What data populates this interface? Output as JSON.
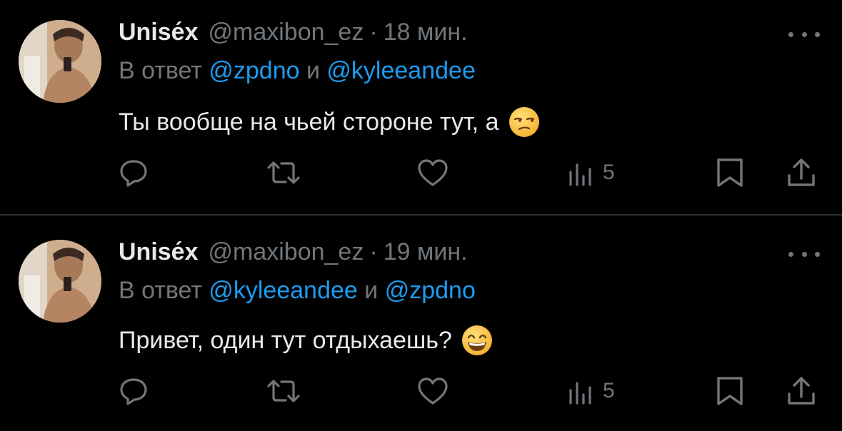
{
  "tweets": [
    {
      "author": {
        "display_name": "Unisе́x",
        "handle": "@maxibon_ez"
      },
      "separator": "·",
      "time": "18 мин.",
      "reply_prefix": "В ответ",
      "mention_1": "@zpdno",
      "conjunction": "и",
      "mention_2": "@kyleeandee",
      "text": "Ты вообще на чьей стороне тут, а",
      "emoji": "unamused-face",
      "views": "5"
    },
    {
      "author": {
        "display_name": "Unisе́x",
        "handle": "@maxibon_ez"
      },
      "separator": "·",
      "time": "19 мин.",
      "reply_prefix": "В ответ",
      "mention_1": "@kyleeandee",
      "conjunction": "и",
      "mention_2": "@zpdno",
      "text": "Привет, один тут отдыхаешь?",
      "emoji": "grinning-face-with-smiling-eyes",
      "views": "5"
    }
  ],
  "icons": {
    "more": "more-horizontal-icon",
    "reply": "reply-icon",
    "retweet": "retweet-icon",
    "like": "heart-icon",
    "views": "views-icon",
    "bookmark": "bookmark-icon",
    "share": "share-icon"
  },
  "colors": {
    "background": "#000000",
    "text": "#e7e9ea",
    "secondary": "#71767b",
    "mention": "#1d9bf0",
    "divider": "#2f3336"
  }
}
